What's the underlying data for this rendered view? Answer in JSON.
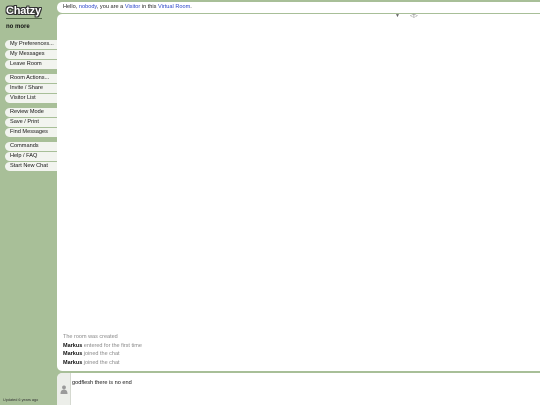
{
  "sidebar": {
    "logo": "Chatzy",
    "room_name": "no more",
    "groups": [
      [
        "My Preferences...",
        "My Messages",
        "Leave Room"
      ],
      [
        "Room Actions...",
        "Invite / Share",
        "Visitor List"
      ],
      [
        "Review Mode",
        "Save / Print",
        "Find Messages"
      ],
      [
        "Commands",
        "Help / FAQ",
        "Start New Chat"
      ]
    ],
    "updated": "Updated 6 years ago"
  },
  "header": {
    "greeting_hello": "Hello,",
    "user_name": "nobody",
    "greeting_mid": ", you are a",
    "role": "Visitor",
    "greeting_in": "in this",
    "room_type": "Virtual Room",
    "greeting_end": "."
  },
  "chat": {
    "scroll_down_glyph": "▼",
    "scroll_up_glyph": "◁▷",
    "messages": [
      {
        "name": "",
        "text": "The room was created"
      },
      {
        "name": "Markus",
        "text": "entered for the first time"
      },
      {
        "name": "Markus",
        "text": "joined the chat"
      },
      {
        "name": "Markus",
        "text": "joined the chat"
      }
    ]
  },
  "input": {
    "value": "godflesh there is no end"
  }
}
